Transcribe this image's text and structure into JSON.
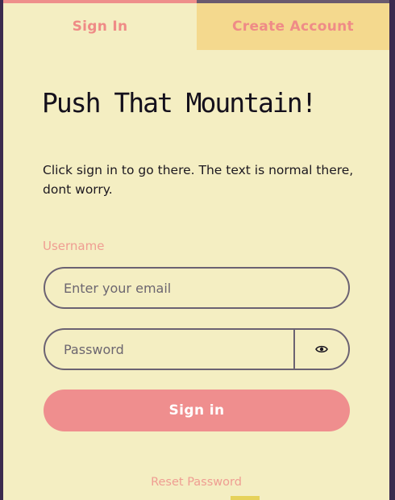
{
  "tabs": {
    "sign_in": "Sign In",
    "create_account": "Create Account"
  },
  "main": {
    "title": "Push That Mountain!",
    "description": "Click sign in to go there. The text is normal there, dont worry."
  },
  "form": {
    "username_label": "Username",
    "email_placeholder": "Enter your email",
    "password_placeholder": "Password",
    "eye_icon": "eye-icon",
    "submit_label": "Sign in",
    "reset_link": "Reset Password"
  },
  "colors": {
    "background": "#f4eec2",
    "tab_inactive": "#f4d98e",
    "accent": "#ef8e8e",
    "frame": "#3b2a4e"
  }
}
